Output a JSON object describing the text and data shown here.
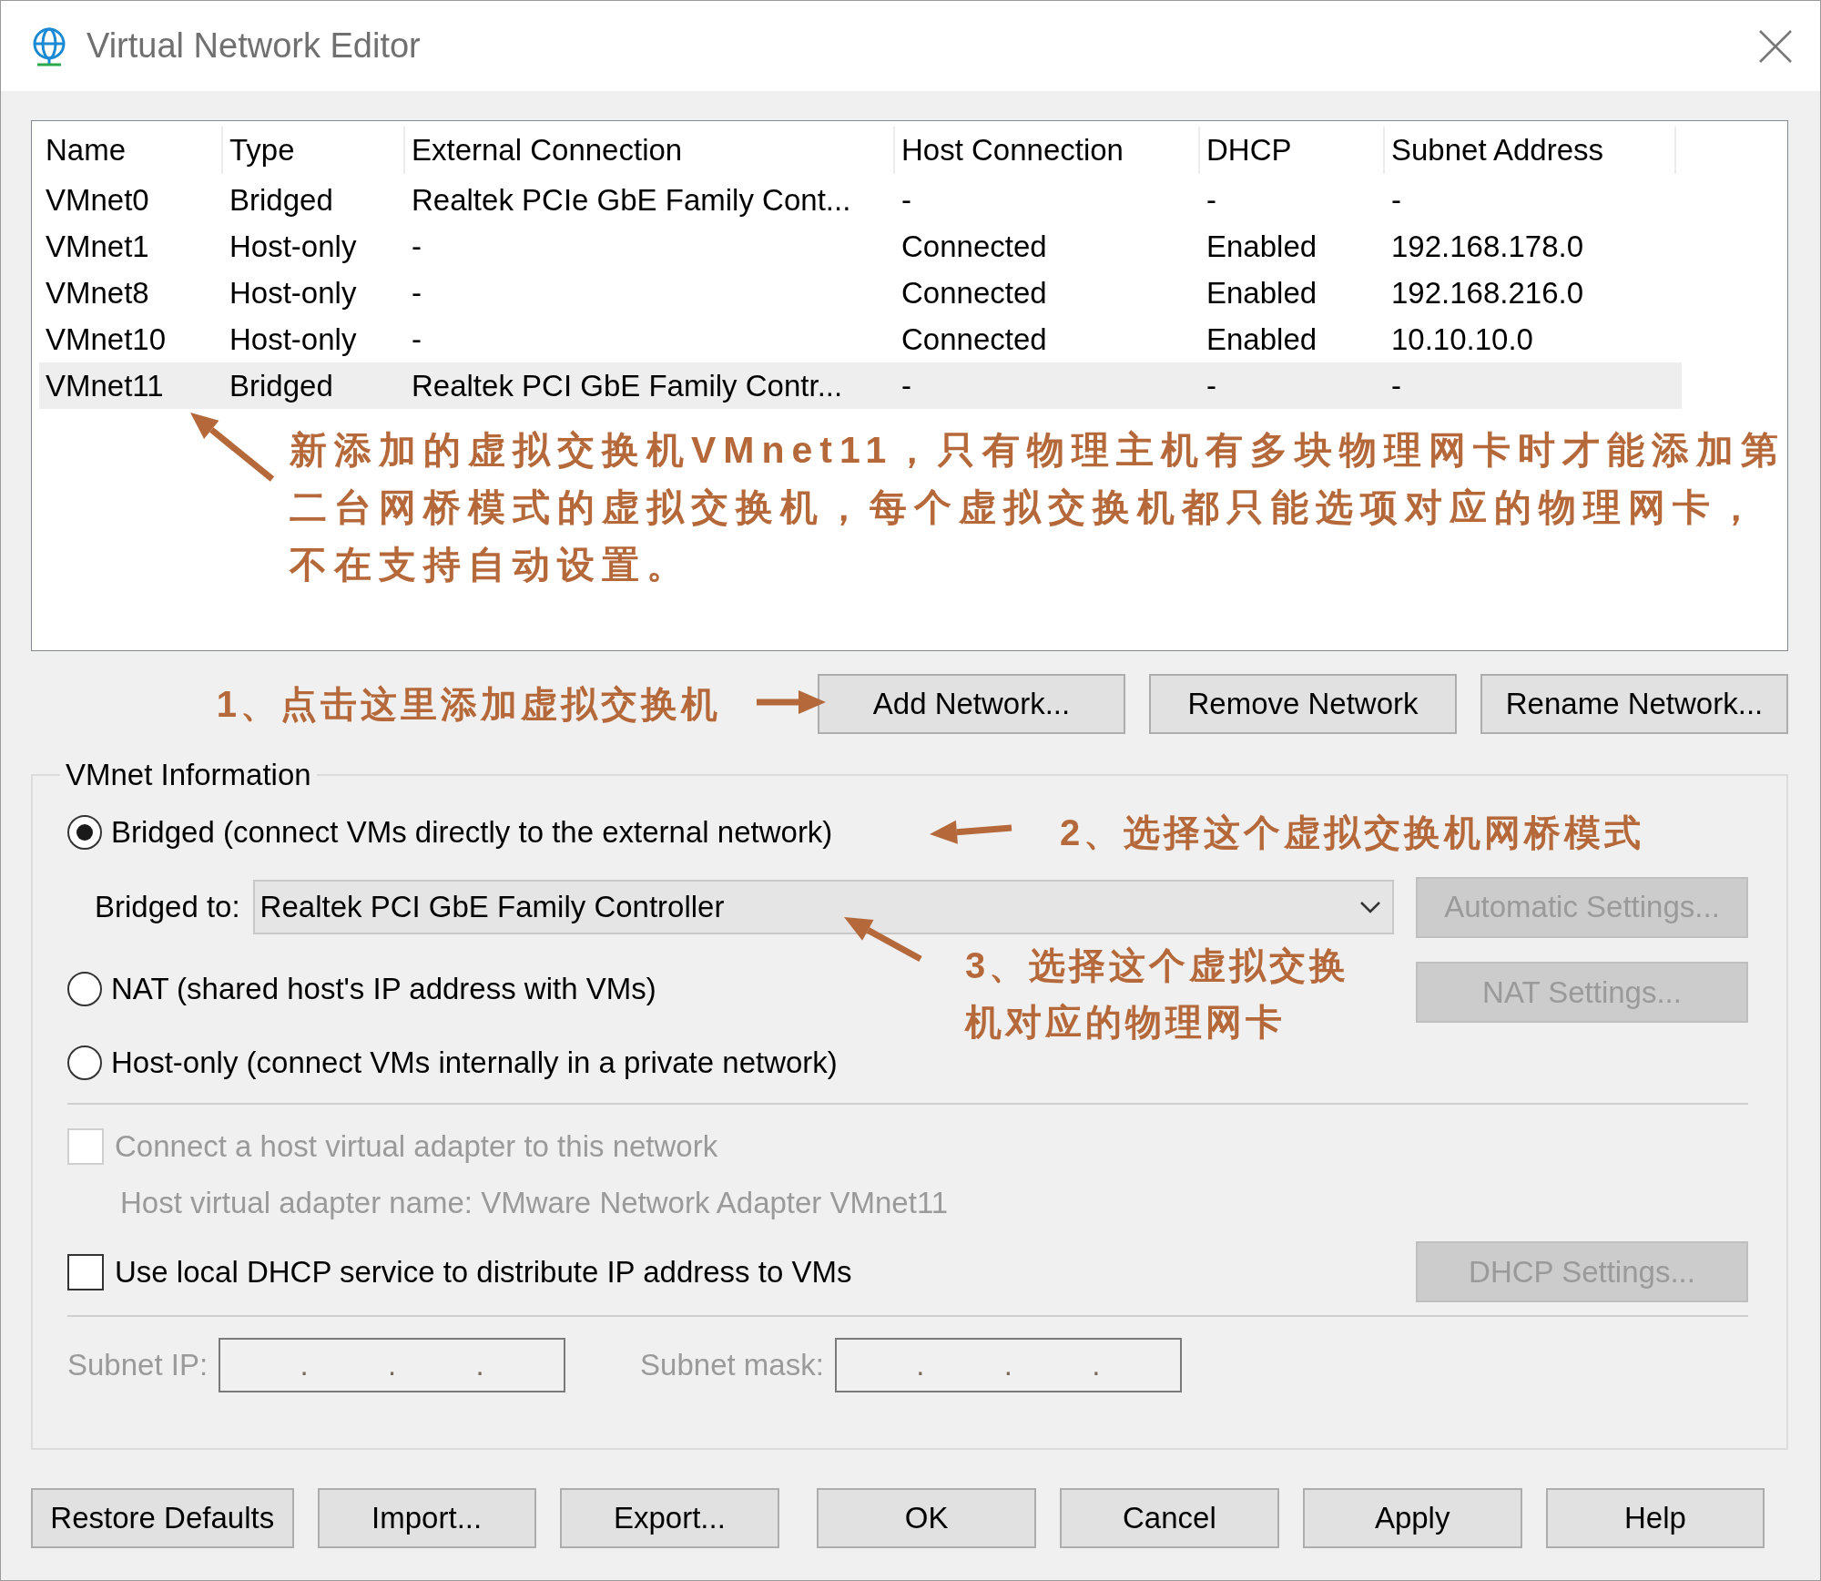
{
  "window": {
    "title": "Virtual Network Editor"
  },
  "table": {
    "columns": [
      "Name",
      "Type",
      "External Connection",
      "Host Connection",
      "DHCP",
      "Subnet Address"
    ],
    "rows": [
      {
        "cells": [
          "VMnet0",
          "Bridged",
          "Realtek PCIe GbE Family Cont...",
          "-",
          "-",
          "-"
        ],
        "selected": false
      },
      {
        "cells": [
          "VMnet1",
          "Host-only",
          "-",
          "Connected",
          "Enabled",
          "192.168.178.0"
        ],
        "selected": false
      },
      {
        "cells": [
          "VMnet8",
          "Host-only",
          "-",
          "Connected",
          "Enabled",
          "192.168.216.0"
        ],
        "selected": false
      },
      {
        "cells": [
          "VMnet10",
          "Host-only",
          "-",
          "Connected",
          "Enabled",
          "10.10.10.0"
        ],
        "selected": false
      },
      {
        "cells": [
          "VMnet11",
          "Bridged",
          "Realtek PCI GbE Family Contr...",
          "-",
          "-",
          "-"
        ],
        "selected": true
      }
    ],
    "annotation": "新添加的虚拟交换机VMnet11，只有物理主机有多块物理网卡时才能添加第二台网桥模式的虚拟交换机，每个虚拟交换机都只能选项对应的物理网卡，不在支持自动设置。"
  },
  "network_buttons": {
    "annotation": "1、点击这里添加虚拟交换机",
    "buttons": [
      "Add Network...",
      "Remove Network",
      "Rename Network..."
    ]
  },
  "vmnet_information": {
    "title": "VMnet Information",
    "modes": [
      {
        "label": "Bridged (connect VMs directly to the external network)",
        "selected": true
      },
      {
        "label": "NAT (shared host's IP address with VMs)",
        "selected": false
      },
      {
        "label": "Host-only (connect VMs internally in a private network)",
        "selected": false
      }
    ],
    "mode_annotation": "2、选择这个虚拟交换机网桥模式",
    "bridged_to": {
      "label": "Bridged to:",
      "value": "Realtek PCI GbE Family Controller",
      "annotation": "3、选择这个虚拟交换机对应的物理网卡"
    },
    "automatic_settings_button": {
      "label": "Automatic Settings...",
      "disabled": true
    },
    "nat_settings_button": {
      "label": "NAT Settings...",
      "disabled": true
    },
    "host_adapter": {
      "label": "Connect a host virtual adapter to this network",
      "checked": false,
      "disabled": true,
      "adapter_name": "Host virtual adapter name: VMware Network Adapter VMnet11"
    },
    "dhcp": {
      "label": "Use local DHCP service to distribute IP address to VMs",
      "checked": false,
      "disabled": false,
      "settings_button": {
        "label": "DHCP Settings...",
        "disabled": true
      }
    },
    "subnet_ip": {
      "label": "Subnet IP:",
      "separators": [
        ".",
        ".",
        "."
      ],
      "disabled": true
    },
    "subnet_mask": {
      "label": "Subnet mask:",
      "separators": [
        ".",
        ".",
        "."
      ],
      "disabled": true
    }
  },
  "dialog_buttons": [
    "Restore Defaults",
    "Import...",
    "Export...",
    "OK",
    "Cancel",
    "Apply",
    "Help"
  ]
}
